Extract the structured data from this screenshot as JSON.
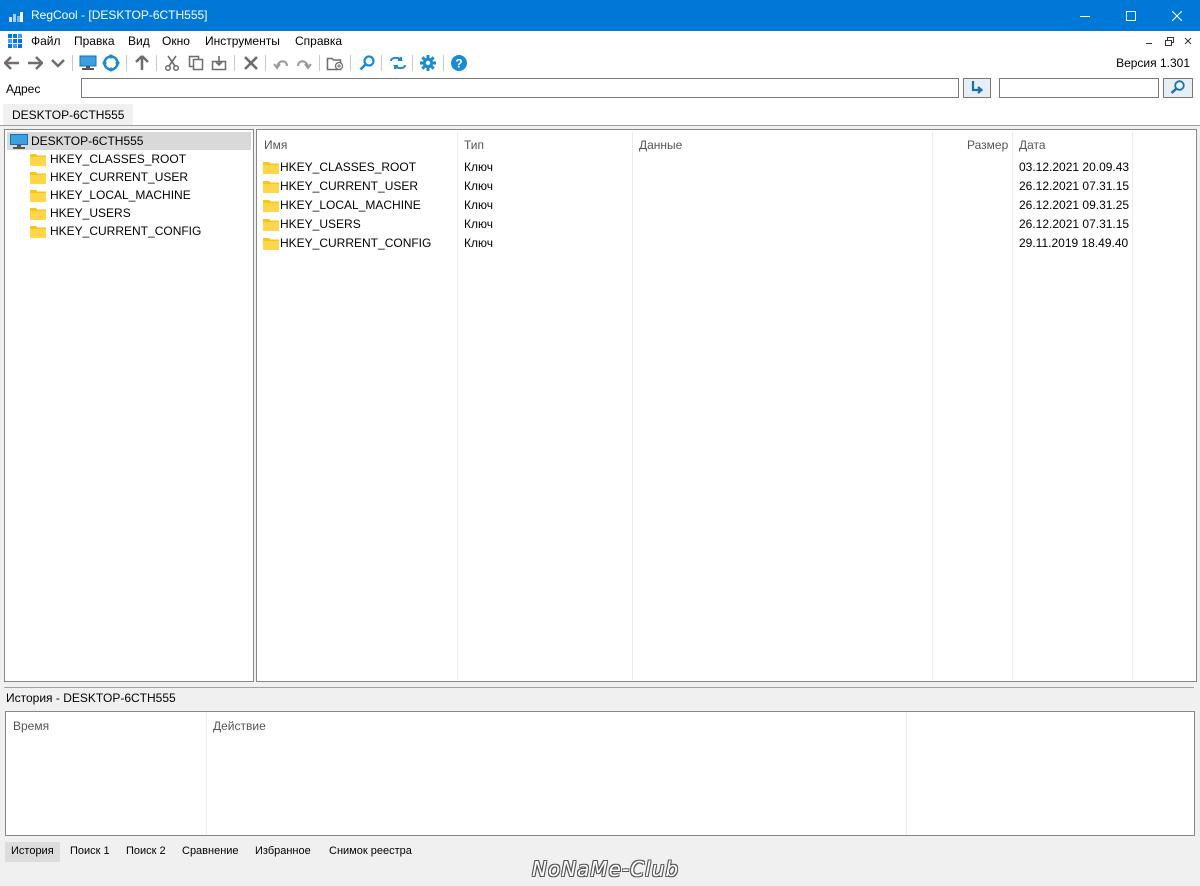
{
  "window": {
    "title": "RegCool - [DESKTOP-6CTH555]",
    "accent_color": "#0078d7"
  },
  "menu": {
    "items": [
      "Файл",
      "Правка",
      "Вид",
      "Окно",
      "Инструменты",
      "Справка"
    ]
  },
  "toolbar": {
    "version": "Версия 1.301",
    "icons": [
      "back-arrow",
      "forward-arrow",
      "dropdown",
      "computer",
      "refresh",
      "up-arrow",
      "cut",
      "copy",
      "export",
      "delete",
      "undo",
      "redo",
      "new-key",
      "search",
      "compare",
      "settings",
      "help"
    ]
  },
  "address": {
    "label": "Адрес",
    "value": "",
    "search_value": ""
  },
  "doc_tab": "DESKTOP-6CTH555",
  "tree": {
    "root": "DESKTOP-6CTH555",
    "items": [
      "HKEY_CLASSES_ROOT",
      "HKEY_CURRENT_USER",
      "HKEY_LOCAL_MACHINE",
      "HKEY_USERS",
      "HKEY_CURRENT_CONFIG"
    ]
  },
  "list": {
    "columns": {
      "name": "Имя",
      "type": "Тип",
      "data": "Данные",
      "size": "Размер",
      "date": "Дата"
    },
    "rows": [
      {
        "name": "HKEY_CLASSES_ROOT",
        "type": "Ключ",
        "date": "03.12.2021 20.09.43"
      },
      {
        "name": "HKEY_CURRENT_USER",
        "type": "Ключ",
        "date": "26.12.2021 07.31.15"
      },
      {
        "name": "HKEY_LOCAL_MACHINE",
        "type": "Ключ",
        "date": "26.12.2021 09.31.25"
      },
      {
        "name": "HKEY_USERS",
        "type": "Ключ",
        "date": "26.12.2021 07.31.15"
      },
      {
        "name": "HKEY_CURRENT_CONFIG",
        "type": "Ключ",
        "date": "29.11.2019 18.49.40"
      }
    ]
  },
  "history": {
    "title": "История - DESKTOP-6CTH555",
    "columns": {
      "time": "Время",
      "action": "Действие"
    }
  },
  "bottom_tabs": [
    "История",
    "Поиск 1",
    "Поиск 2",
    "Сравнение",
    "Избранное",
    "Снимок реестра"
  ],
  "watermark": "NoNaMe-Club"
}
